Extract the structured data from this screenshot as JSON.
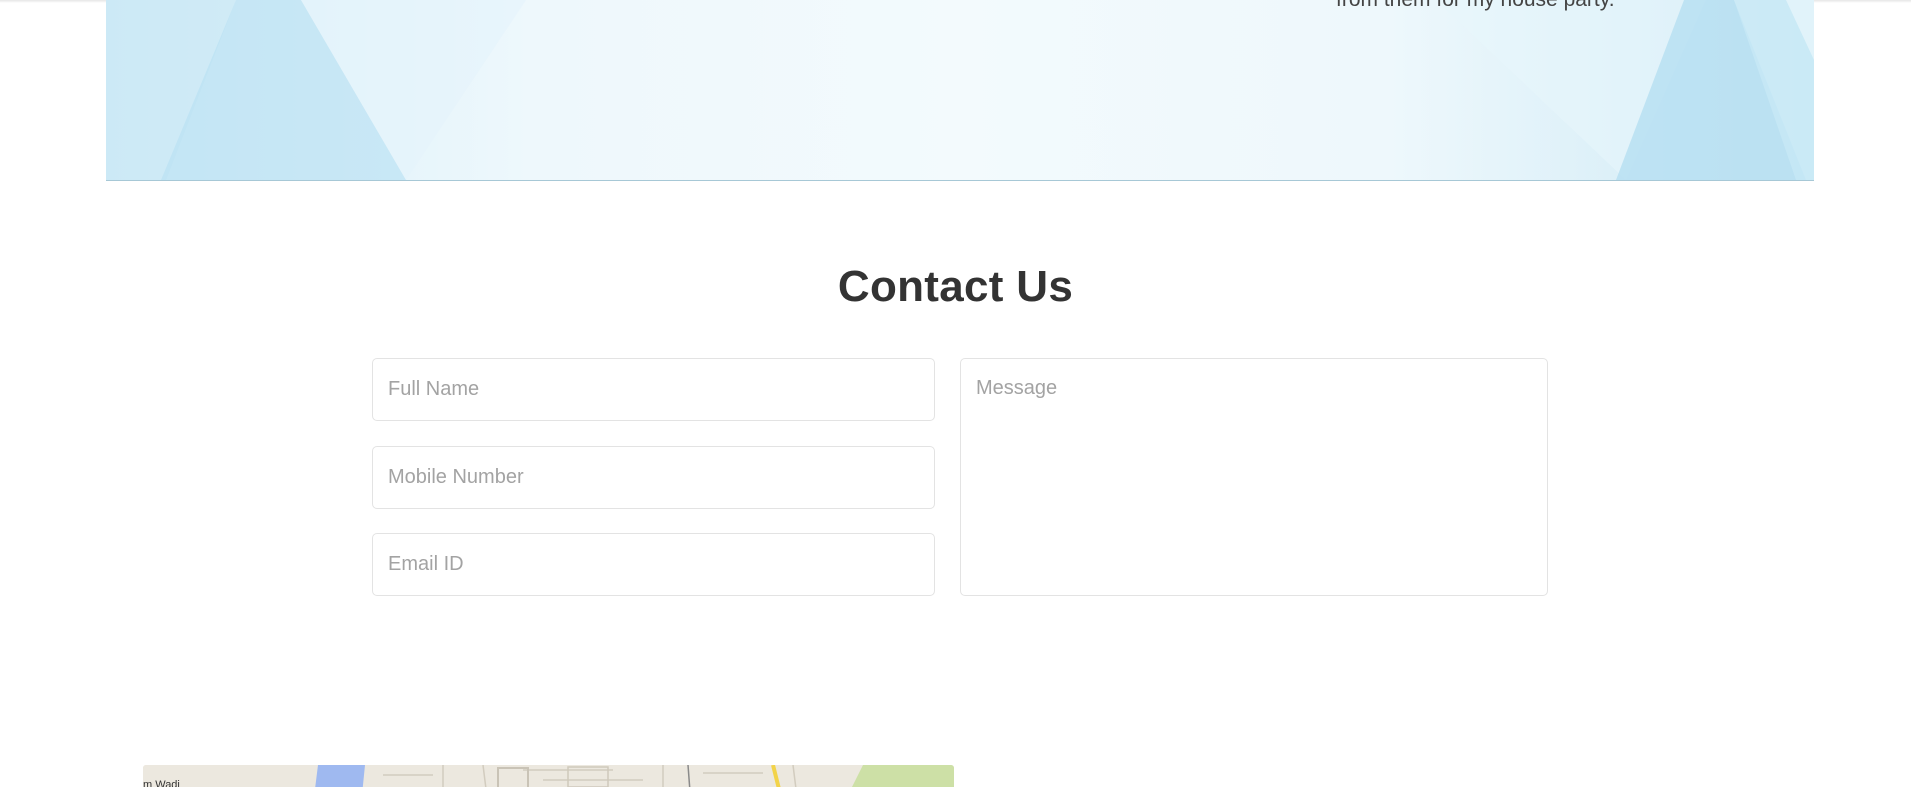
{
  "banner": {
    "quote_tail": "from them for my house party."
  },
  "contact": {
    "title": "Contact Us",
    "full_name_placeholder": "Full Name",
    "mobile_placeholder": "Mobile Number",
    "email_placeholder": "Email ID",
    "message_placeholder": "Message"
  },
  "map": {
    "place_label": "m Wadi"
  },
  "colors": {
    "banner_light": "#eef8fc",
    "banner_accent": "#bfe3f3",
    "title": "#333333",
    "field_border": "#e3e3e3",
    "placeholder": "#a3a3a3"
  }
}
